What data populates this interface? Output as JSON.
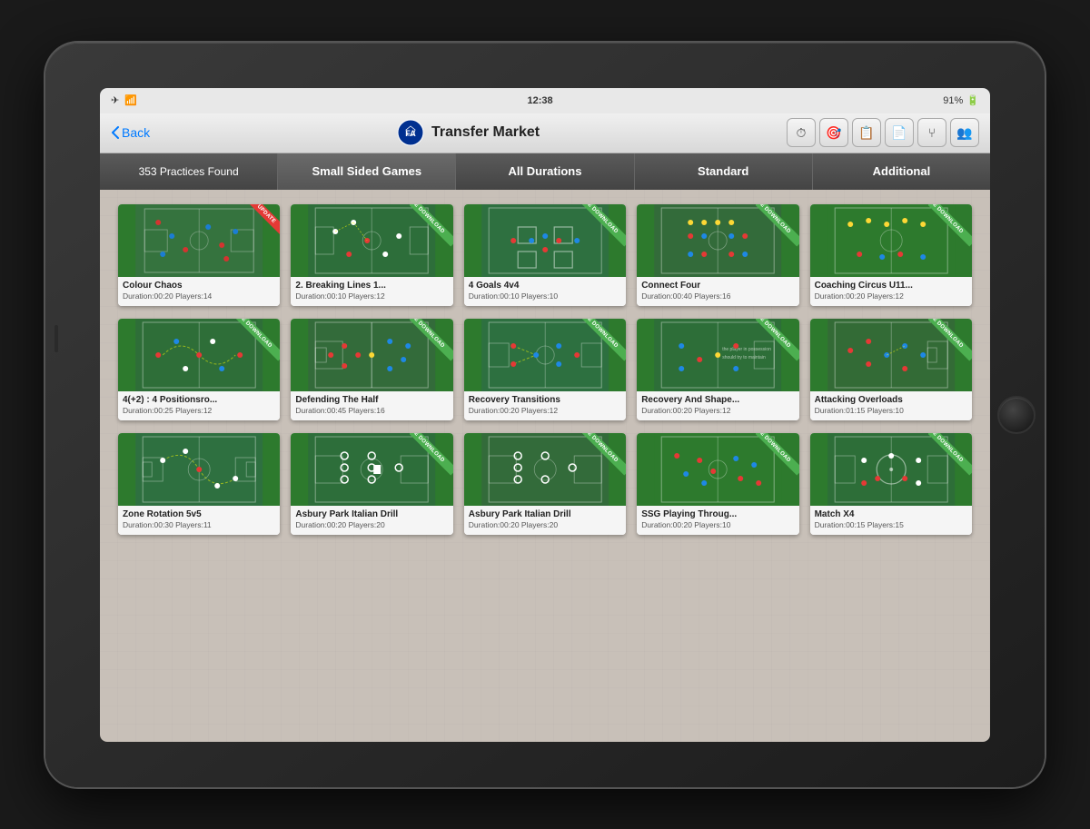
{
  "device": {
    "status_bar": {
      "time": "12:38",
      "battery": "91%",
      "signal": "●●●",
      "wifi": "wifi"
    }
  },
  "nav": {
    "back_label": "Back",
    "logo_alt": "FA Logo",
    "title": "Transfer Market",
    "icons": [
      "clock",
      "target",
      "calendar",
      "clipboard",
      "fork",
      "people"
    ]
  },
  "filters": {
    "count_label": "353 Practices Found",
    "category_label": "Small Sided Games",
    "duration_label": "All Durations",
    "standard_label": "Standard",
    "additional_label": "Additional"
  },
  "practices": [
    {
      "title": "Colour Chaos",
      "duration": "Duration:00:20",
      "players": "Players:14",
      "badge": "update",
      "badge_text": "UPDATE",
      "field_color": "#3a7d44"
    },
    {
      "title": "2. Breaking Lines 1...",
      "duration": "Duration:00:10",
      "players": "Players:12",
      "badge": "free",
      "badge_text": "FREE DOWNLOAD",
      "field_color": "#2d6e3a"
    },
    {
      "title": "4 Goals 4v4",
      "duration": "Duration:00:10",
      "players": "Players:10",
      "badge": "free",
      "badge_text": "FREE DOWNLOAD",
      "field_color": "#2e7040"
    },
    {
      "title": "Connect Four",
      "duration": "Duration:00:40",
      "players": "Players:16",
      "badge": "free",
      "badge_text": "FREE DOWNLOAD",
      "field_color": "#336b3a"
    },
    {
      "title": "Coaching Circus U11...",
      "duration": "Duration:00:20",
      "players": "Players:12",
      "badge": "free",
      "badge_text": "FREE DOWNLOAD",
      "field_color": "#2d7a2d"
    },
    {
      "title": "4(+2) : 4 Positionsro...",
      "duration": "Duration:00:25",
      "players": "Players:12",
      "badge": "free",
      "badge_text": "FREE DOWNLOAD",
      "field_color": "#2e6e38"
    },
    {
      "title": "Defending The Half",
      "duration": "Duration:00:45",
      "players": "Players:16",
      "badge": "free",
      "badge_text": "FREE DOWNLOAD",
      "field_color": "#336b3a"
    },
    {
      "title": "Recovery Transitions",
      "duration": "Duration:00:20",
      "players": "Players:12",
      "badge": "free",
      "badge_text": "FREE DOWNLOAD",
      "field_color": "#2d7040"
    },
    {
      "title": "Recovery And Shape...",
      "duration": "Duration:00:20",
      "players": "Players:12",
      "badge": "free",
      "badge_text": "FREE DOWNLOAD",
      "field_color": "#2d6e38"
    },
    {
      "title": "Attacking Overloads",
      "duration": "Duration:01:15",
      "players": "Players:10",
      "badge": "free",
      "badge_text": "FREE DOWNLOAD",
      "field_color": "#336b36"
    },
    {
      "title": "Zone Rotation 5v5",
      "duration": "Duration:00:30",
      "players": "Players:11",
      "badge": "none",
      "badge_text": "",
      "field_color": "#2e7040"
    },
    {
      "title": "Asbury Park Italian Drill",
      "duration": "Duration:00:20",
      "players": "Players:20",
      "badge": "free",
      "badge_text": "FREE DOWNLOAD",
      "field_color": "#2d6e3a"
    },
    {
      "title": "Asbury Park Italian Drill",
      "duration": "Duration:00:20",
      "players": "Players:20",
      "badge": "free",
      "badge_text": "FREE DOWNLOAD",
      "field_color": "#336b3a"
    },
    {
      "title": "SSG Playing Throug...",
      "duration": "Duration:00:20",
      "players": "Players:10",
      "badge": "free",
      "badge_text": "FREE DOWNLOAD",
      "field_color": "#2d7a2d"
    },
    {
      "title": "Match X4",
      "duration": "Duration:00:15",
      "players": "Players:15",
      "badge": "free",
      "badge_text": "FREE DOWNLOAD",
      "field_color": "#2d6e38"
    }
  ]
}
